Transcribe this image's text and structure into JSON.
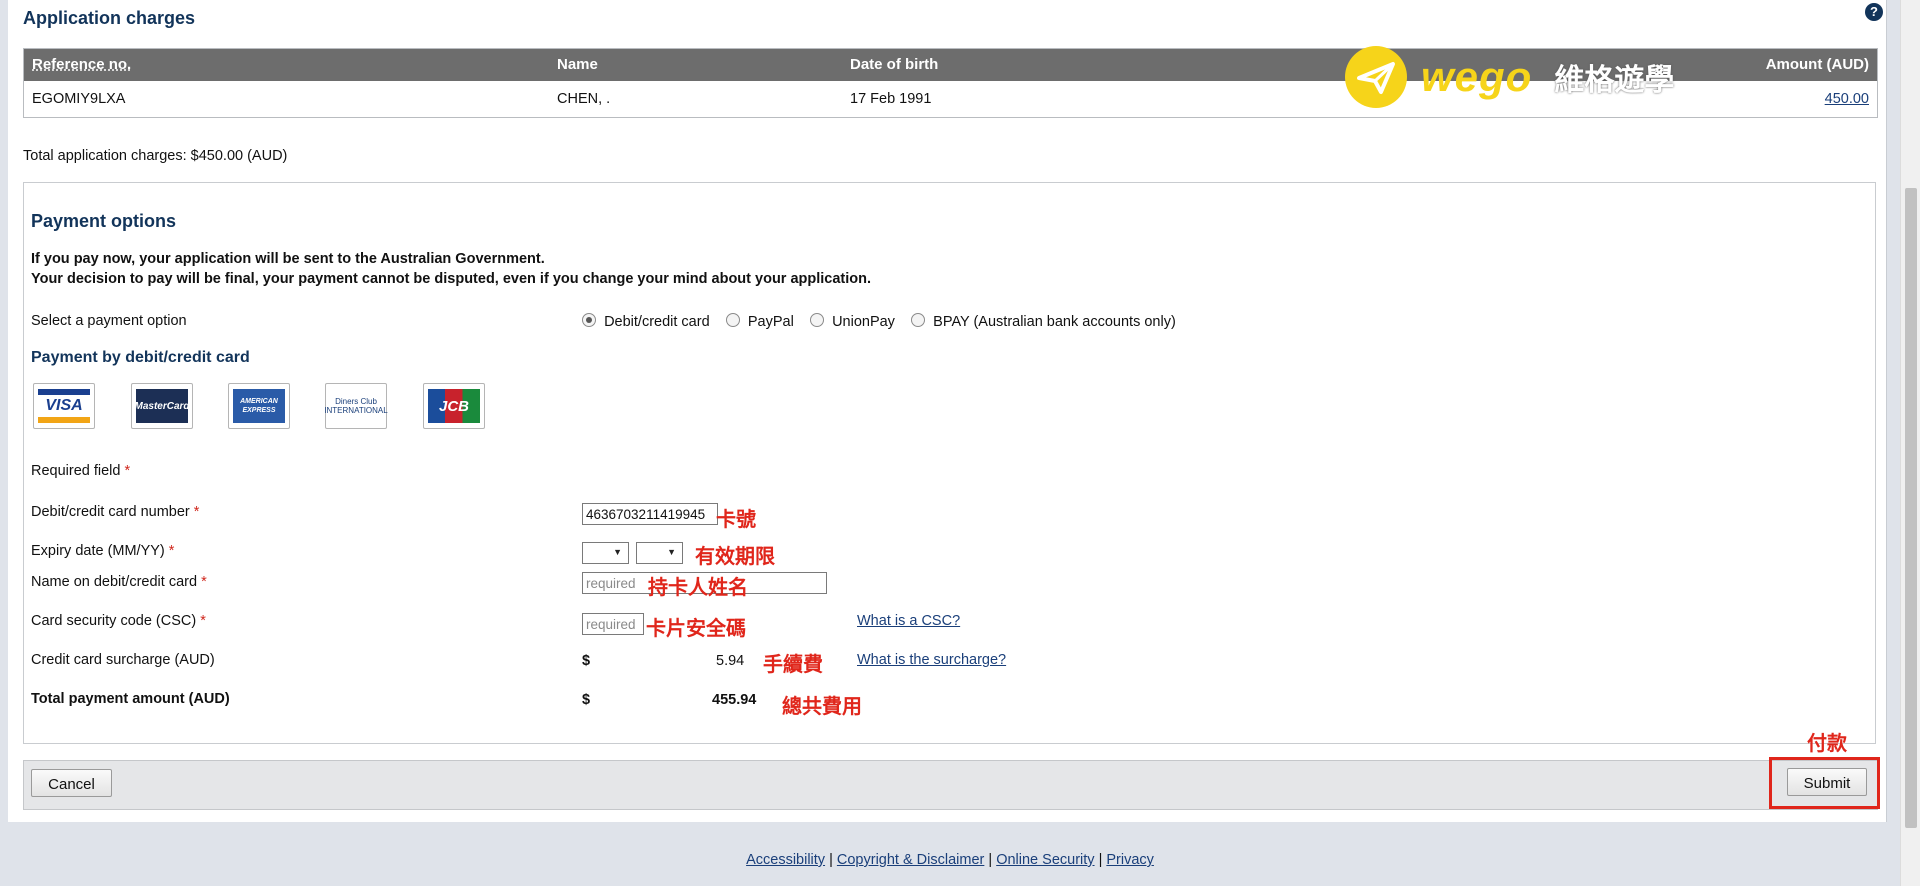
{
  "header": {
    "title": "Application charges",
    "help_icon": "?"
  },
  "charges_table": {
    "columns": [
      "Reference no.",
      "Name",
      "Date of birth",
      "Amount (AUD)"
    ],
    "rows": [
      {
        "reference": "EGOMIY9LXA",
        "name": "CHEN, .",
        "dob": "17 Feb 1991",
        "amount": "450.00"
      }
    ]
  },
  "watermark": {
    "logo": "wego",
    "text": "維格遊學"
  },
  "total_charges": "Total application charges: $450.00 (AUD)",
  "payment_options": {
    "title": "Payment options",
    "notice_line1": "If you pay now, your application will be sent to the Australian Government.",
    "notice_line2": "Your decision to pay will be final, your payment cannot be disputed, even if you change your mind about your application.",
    "select_label": "Select a payment option",
    "options": [
      {
        "label": "Debit/credit card",
        "selected": true
      },
      {
        "label": "PayPal",
        "selected": false
      },
      {
        "label": "UnionPay",
        "selected": false
      },
      {
        "label": "BPAY (Australian bank accounts only)",
        "selected": false
      }
    ],
    "card_section_title": "Payment by debit/credit card",
    "cards": [
      "VISA",
      "MasterCard",
      "AMERICAN EXPRESS",
      "Diners Club INTERNATIONAL",
      "JCB"
    ],
    "required_field": "Required field",
    "required_mark": "*"
  },
  "form": {
    "card_number_label": "Debit/credit card number",
    "card_number_value": "4636703211419945",
    "expiry_label": "Expiry date (MM/YY)",
    "name_label": "Name on debit/credit card",
    "name_placeholder": "required",
    "csc_label": "Card security code (CSC)",
    "csc_placeholder": "required",
    "csc_link": "What is a CSC?",
    "surcharge_label": "Credit card surcharge (AUD)",
    "surcharge_currency": "$",
    "surcharge_value": "5.94",
    "surcharge_link": "What is the surcharge?",
    "total_label": "Total payment amount (AUD)",
    "total_currency": "$",
    "total_value": "455.94"
  },
  "annotations": {
    "card_number": "卡號",
    "expiry": "有效期限",
    "name": "持卡人姓名",
    "csc": "卡片安全碼",
    "surcharge": "手續費",
    "total": "總共費用",
    "submit": "付款"
  },
  "buttons": {
    "cancel": "Cancel",
    "submit": "Submit"
  },
  "footer": {
    "links": [
      "Accessibility",
      "Copyright & Disclaimer",
      "Online Security",
      "Privacy"
    ],
    "separator": "|"
  },
  "colors": {
    "heading": "#12345a",
    "table_header": "#6d6d6d",
    "annotation_red": "#e0261b",
    "required_red": "#d0271d",
    "wego_yellow": "#f6d41a"
  }
}
